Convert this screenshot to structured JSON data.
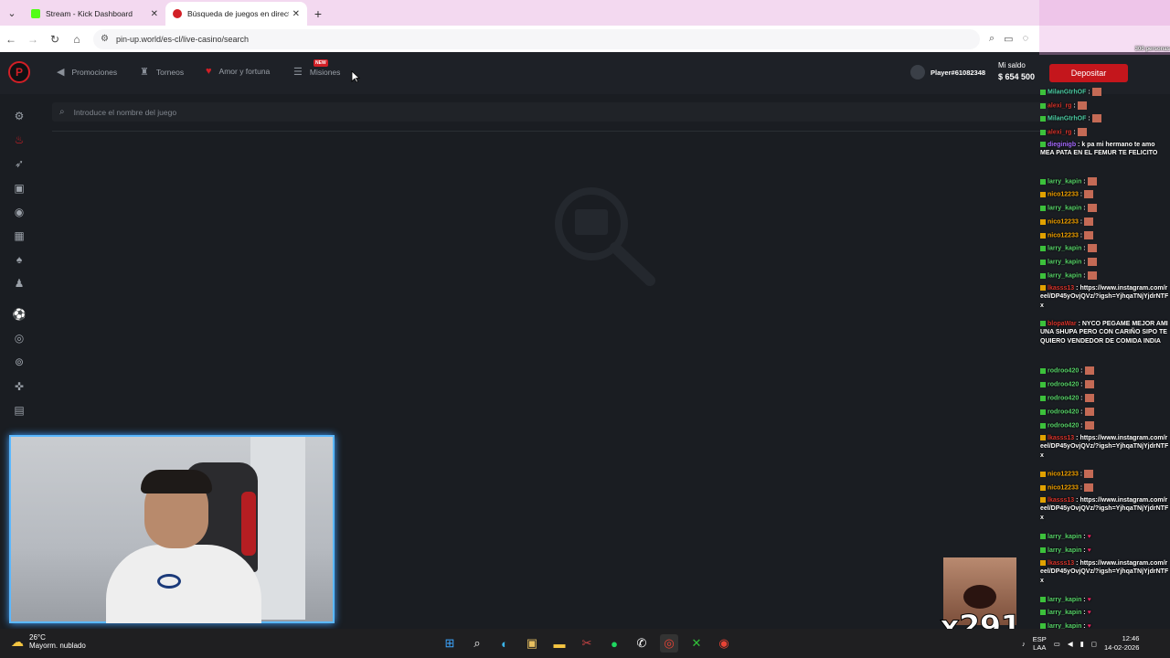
{
  "browser": {
    "tabs": [
      {
        "title": "Stream - Kick Dashboard",
        "favicon_color": "#53fc18",
        "active": false
      },
      {
        "title": "Búsqueda de juegos en directo",
        "favicon_color": "#d21f26",
        "active": true
      }
    ],
    "url": "pin-up.world/es-cl/live-casino/search"
  },
  "site": {
    "logo": "P",
    "nav": [
      {
        "label": "Promociones",
        "icon": "megaphone-icon"
      },
      {
        "label": "Torneos",
        "icon": "trophy-icon"
      },
      {
        "label": "Amor y fortuna",
        "icon": "heart-icon"
      },
      {
        "label": "Misiones",
        "icon": "missions-icon",
        "badge": "NEW"
      }
    ],
    "user": {
      "name": "Player#61082348"
    },
    "balance": {
      "label": "Mi saldo",
      "value": "$ 654 500"
    },
    "deposit_label": "Depositar",
    "search_placeholder": "Introduce el nombre del juego",
    "sidebar_icons": [
      "gear-icon",
      "fire-icon",
      "rocket-icon",
      "tv-icon",
      "live-icon",
      "slot-icon",
      "cards-icon",
      "dealer-icon",
      "sports-icon",
      "roulette-icon",
      "wheel-icon",
      "gamepad-icon",
      "news-icon"
    ]
  },
  "chat": {
    "viewers": "300 personas",
    "messages": [
      {
        "user": "MilanGtrhOF",
        "color": "mint",
        "text": ""
      },
      {
        "user": "alexi_rg",
        "color": "red",
        "text": ""
      },
      {
        "user": "MilanGtrhOF",
        "color": "mint",
        "text": ""
      },
      {
        "user": "alexi_rg",
        "color": "red",
        "text": ""
      },
      {
        "user": "dieginigb",
        "color": "purple",
        "text": "k pa mi hermano te amo MEA PATA EN EL FEMUR TE FELICITO"
      },
      {
        "user": "larry_kapin",
        "color": "green",
        "text": ""
      },
      {
        "user": "nico12233",
        "color": "orange",
        "text": ""
      },
      {
        "user": "larry_kapin",
        "color": "green",
        "text": ""
      },
      {
        "user": "nico12233",
        "color": "orange",
        "text": ""
      },
      {
        "user": "nico12233",
        "color": "orange",
        "text": ""
      },
      {
        "user": "larry_kapin",
        "color": "green",
        "text": ""
      },
      {
        "user": "larry_kapin",
        "color": "green",
        "text": ""
      },
      {
        "user": "larry_kapin",
        "color": "green",
        "text": ""
      },
      {
        "user": "lkasss13",
        "color": "red",
        "text": "https://www.instagram.com/reel/DP45yOvjQVz/?igsh=YjhqaTNjYjdrNTFx"
      },
      {
        "user": "blopaWar",
        "color": "red",
        "text": "NYCO PEGAME MEJOR AMI UNA SHUPA PERO CON CARIÑO SIPO TE QUIERO VENDEDOR DE COMIDA INDIA"
      },
      {
        "user": "rodroo420",
        "color": "green",
        "text": ""
      },
      {
        "user": "rodroo420",
        "color": "green",
        "text": ""
      },
      {
        "user": "rodroo420",
        "color": "green",
        "text": ""
      },
      {
        "user": "rodroo420",
        "color": "green",
        "text": ""
      },
      {
        "user": "rodroo420",
        "color": "green",
        "text": ""
      },
      {
        "user": "lkasss13",
        "color": "red",
        "text": "https://www.instagram.com/reel/DP45yOvjQVz/?igsh=YjhqaTNjYjdrNTFx"
      },
      {
        "user": "nico12233",
        "color": "orange",
        "text": ""
      },
      {
        "user": "nico12233",
        "color": "orange",
        "text": ""
      },
      {
        "user": "lkasss13",
        "color": "red",
        "text": "https://www.instagram.com/reel/DP45yOvjQVz/?igsh=YjhqaTNjYjdrNTFx"
      },
      {
        "user": "larry_kapin",
        "color": "green",
        "text": ""
      },
      {
        "user": "larry_kapin",
        "color": "green",
        "text": ""
      },
      {
        "user": "lkasss13",
        "color": "red",
        "text": "https://www.instagram.com/reel/DP45yOvjQVz/?igsh=YjhqaTNjYjdrNTFx"
      },
      {
        "user": "larry_kapin",
        "color": "green",
        "text": ""
      },
      {
        "user": "larry_kapin",
        "color": "green",
        "text": ""
      },
      {
        "user": "larry_kapin",
        "color": "green",
        "text": ""
      }
    ]
  },
  "meme_counter": "x291",
  "taskbar": {
    "weather": {
      "temp": "26°C",
      "desc": "Mayorm. nublado"
    },
    "lang": [
      "ESP",
      "LAA"
    ],
    "time": "12:46",
    "date": "14-02-2026"
  }
}
